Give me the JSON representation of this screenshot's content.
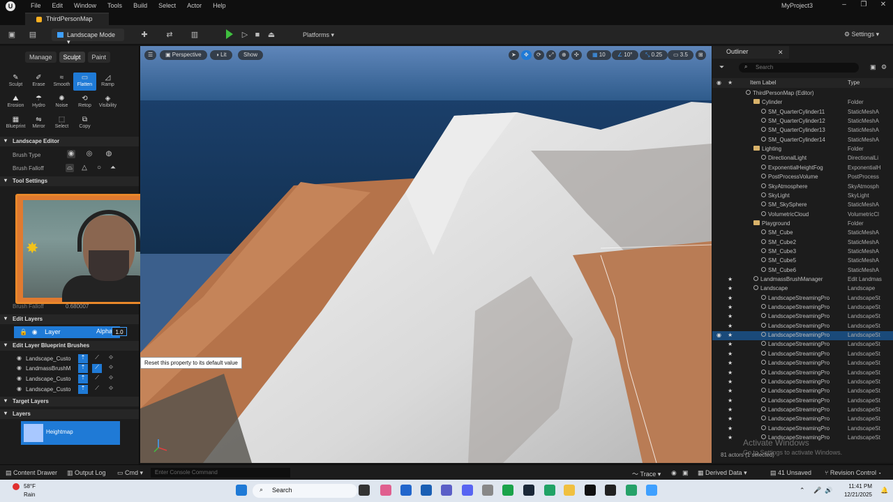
{
  "menu": [
    "File",
    "Edit",
    "Window",
    "Tools",
    "Build",
    "Select",
    "Actor",
    "Help"
  ],
  "project_name": "MyProject3",
  "map_tab": "ThirdPersonMap",
  "toolbar": {
    "mode": "Landscape Mode",
    "platforms": "Platforms",
    "settings": "Settings"
  },
  "left": {
    "mode_tabs": [
      "Manage",
      "Sculpt",
      "Paint"
    ],
    "tools": [
      {
        "label": "Sculpt",
        "glyph": "✎"
      },
      {
        "label": "Erase",
        "glyph": "✐"
      },
      {
        "label": "Smooth",
        "glyph": "≈"
      },
      {
        "label": "Flatten",
        "glyph": "▭"
      },
      {
        "label": "Ramp",
        "glyph": "◿"
      },
      {
        "label": "Erosion",
        "glyph": "⛰"
      },
      {
        "label": "Hydro",
        "glyph": "☂"
      },
      {
        "label": "Noise",
        "glyph": "✺"
      },
      {
        "label": "Retop",
        "glyph": "⟲"
      },
      {
        "label": "Visibility",
        "glyph": "◈"
      },
      {
        "label": "Blueprint",
        "glyph": "▦"
      },
      {
        "label": "Mirror",
        "glyph": "⇋"
      },
      {
        "label": "Select",
        "glyph": "⬚"
      },
      {
        "label": "Copy",
        "glyph": "⧉"
      }
    ],
    "landscape_editor": "Landscape Editor",
    "brush_type": "Brush Type",
    "brush_falloff": "Brush Falloff",
    "tool_settings": "Tool Settings",
    "brush_falloff_row": "Brush Falloff",
    "brush_falloff_value": "0.680007",
    "edit_layers": "Edit Layers",
    "layer_name": "Layer",
    "alpha_label": "Alpha",
    "alpha_value": "1.0",
    "blueprint_brushes": "Edit Layer Blueprint Brushes",
    "bp_rows": [
      "Landscape_Custo",
      "LandmassBrushM",
      "Landscape_Custo",
      "Landscape_Custo"
    ],
    "target_layers": "Target Layers",
    "layers": "Layers",
    "heightmap": "Heightmap"
  },
  "viewport": {
    "perspective": "Perspective",
    "lit": "Lit",
    "show": "Show",
    "grid_snap": "10",
    "rot_snap": "10°",
    "scale_snap": "0.25",
    "cam_speed": "3.5",
    "tooltip": "Reset this property to its default value"
  },
  "outliner": {
    "title": "Outliner",
    "search_placeholder": "Search",
    "col_label": "Item Label",
    "col_type": "Type",
    "rows": [
      {
        "label": "ThirdPersonMap (Editor)",
        "type": "",
        "indent": 2,
        "kind": "map"
      },
      {
        "label": "Cylinder",
        "type": "Folder",
        "indent": 3,
        "kind": "folder"
      },
      {
        "label": "SM_QuarterCylinder11",
        "type": "StaticMeshA",
        "indent": 4,
        "kind": "item"
      },
      {
        "label": "SM_QuarterCylinder12",
        "type": "StaticMeshA",
        "indent": 4,
        "kind": "item"
      },
      {
        "label": "SM_QuarterCylinder13",
        "type": "StaticMeshA",
        "indent": 4,
        "kind": "item"
      },
      {
        "label": "SM_QuarterCylinder14",
        "type": "StaticMeshA",
        "indent": 4,
        "kind": "item"
      },
      {
        "label": "Lighting",
        "type": "Folder",
        "indent": 3,
        "kind": "folder"
      },
      {
        "label": "DirectionalLight",
        "type": "DirectionalLi",
        "indent": 4,
        "kind": "item"
      },
      {
        "label": "ExponentialHeightFog",
        "type": "ExponentialH",
        "indent": 4,
        "kind": "item"
      },
      {
        "label": "PostProcessVolume",
        "type": "PostProcess",
        "indent": 4,
        "kind": "item"
      },
      {
        "label": "SkyAtmosphere",
        "type": "SkyAtmosph",
        "indent": 4,
        "kind": "item"
      },
      {
        "label": "SkyLight",
        "type": "SkyLight",
        "indent": 4,
        "kind": "item"
      },
      {
        "label": "SM_SkySphere",
        "type": "StaticMeshA",
        "indent": 4,
        "kind": "item"
      },
      {
        "label": "VolumetricCloud",
        "type": "VolumetricCl",
        "indent": 4,
        "kind": "item"
      },
      {
        "label": "Playground",
        "type": "Folder",
        "indent": 3,
        "kind": "folder"
      },
      {
        "label": "SM_Cube",
        "type": "StaticMeshA",
        "indent": 4,
        "kind": "item"
      },
      {
        "label": "SM_Cube2",
        "type": "StaticMeshA",
        "indent": 4,
        "kind": "item"
      },
      {
        "label": "SM_Cube3",
        "type": "StaticMeshA",
        "indent": 4,
        "kind": "item"
      },
      {
        "label": "SM_Cube5",
        "type": "StaticMeshA",
        "indent": 4,
        "kind": "item"
      },
      {
        "label": "SM_Cube6",
        "type": "StaticMeshA",
        "indent": 4,
        "kind": "item"
      },
      {
        "label": "LandmassBrushManager",
        "type": "Edit Landmas",
        "indent": 3,
        "kind": "star"
      },
      {
        "label": "Landscape",
        "type": "Landscape",
        "indent": 3,
        "kind": "star"
      },
      {
        "label": "LandscapeStreamingPro",
        "type": "LandscapeSt",
        "indent": 4,
        "kind": "star"
      },
      {
        "label": "LandscapeStreamingPro",
        "type": "LandscapeSt",
        "indent": 4,
        "kind": "star"
      },
      {
        "label": "LandscapeStreamingPro",
        "type": "LandscapeSt",
        "indent": 4,
        "kind": "star"
      },
      {
        "label": "LandscapeStreamingPro",
        "type": "LandscapeSt",
        "indent": 4,
        "kind": "star"
      },
      {
        "label": "LandscapeStreamingPro",
        "type": "LandscapeSt",
        "indent": 4,
        "kind": "star",
        "selected": true
      },
      {
        "label": "LandscapeStreamingPro",
        "type": "LandscapeSt",
        "indent": 4,
        "kind": "star"
      },
      {
        "label": "LandscapeStreamingPro",
        "type": "LandscapeSt",
        "indent": 4,
        "kind": "star"
      },
      {
        "label": "LandscapeStreamingPro",
        "type": "LandscapeSt",
        "indent": 4,
        "kind": "star"
      },
      {
        "label": "LandscapeStreamingPro",
        "type": "LandscapeSt",
        "indent": 4,
        "kind": "star"
      },
      {
        "label": "LandscapeStreamingPro",
        "type": "LandscapeSt",
        "indent": 4,
        "kind": "star"
      },
      {
        "label": "LandscapeStreamingPro",
        "type": "LandscapeSt",
        "indent": 4,
        "kind": "star"
      },
      {
        "label": "LandscapeStreamingPro",
        "type": "LandscapeSt",
        "indent": 4,
        "kind": "star"
      },
      {
        "label": "LandscapeStreamingPro",
        "type": "LandscapeSt",
        "indent": 4,
        "kind": "star"
      },
      {
        "label": "LandscapeStreamingPro",
        "type": "LandscapeSt",
        "indent": 4,
        "kind": "star"
      },
      {
        "label": "LandscapeStreamingPro",
        "type": "LandscapeSt",
        "indent": 4,
        "kind": "star"
      },
      {
        "label": "LandscapeStreamingPro",
        "type": "LandscapeSt",
        "indent": 4,
        "kind": "star"
      }
    ],
    "footer": "81 actors (1 selected)",
    "watermark_title": "Activate Windows",
    "watermark_sub": "Go to Settings to activate Windows."
  },
  "status": {
    "content_drawer": "Content Drawer",
    "output_log": "Output Log",
    "cmd": "Cmd",
    "console_placeholder": "Enter Console Command",
    "trace": "Trace",
    "derived_data": "Derived Data",
    "unsaved": "41 Unsaved",
    "revision": "Revision Control"
  },
  "taskbar": {
    "temp": "58°F",
    "condition": "Rain",
    "search": "Search",
    "time": "11:41 PM",
    "date": "12/21/2025"
  }
}
